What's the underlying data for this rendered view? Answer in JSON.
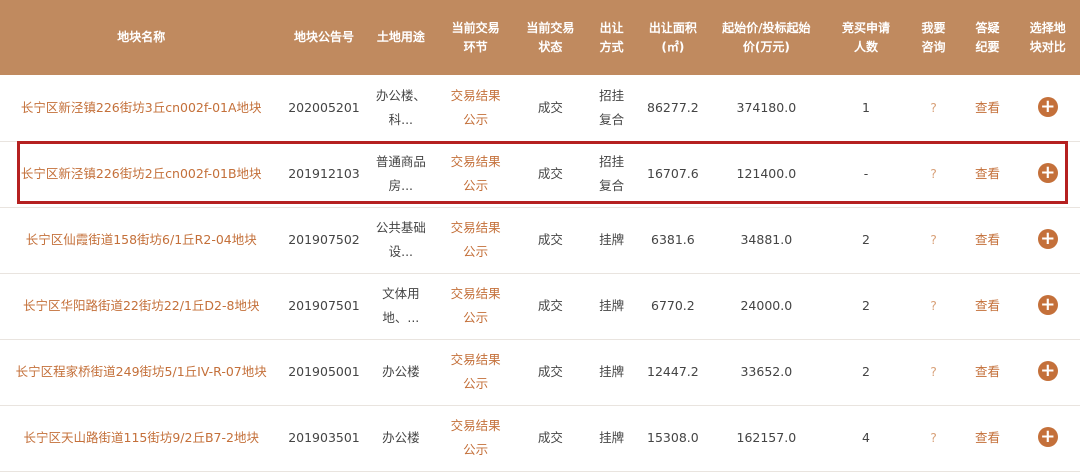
{
  "headers": {
    "name": "地块名称",
    "notice": "地块公告号",
    "usage": "土地用途",
    "stage_1": "当前交易",
    "stage_2": "环节",
    "status_1": "当前交易",
    "status_2": "状态",
    "method_1": "出让",
    "method_2": "方式",
    "area_1": "出让面积",
    "area_2": "(㎡)",
    "price_1": "起始价/投标起始",
    "price_2": "价(万元)",
    "applicants_1": "竞买申请",
    "applicants_2": "人数",
    "consult_1": "我要",
    "consult_2": "咨询",
    "qa_1": "答疑",
    "qa_2": "纪要",
    "compare_1": "选择地",
    "compare_2": "块对比"
  },
  "rows": [
    {
      "name": "长宁区新泾镇226街坊3丘cn002f-01A地块",
      "notice": "202005201",
      "usage_1": "办公楼、",
      "usage_2": "科...",
      "stage_1": "交易结果",
      "stage_2": "公示",
      "status": "成交",
      "method_1": "招挂",
      "method_2": "复合",
      "area": "86277.2",
      "price": "374180.0",
      "applicants": "1",
      "consult": "?",
      "qa": "查看",
      "compare": "+"
    },
    {
      "name": "长宁区新泾镇226街坊2丘cn002f-01B地块",
      "notice": "201912103",
      "usage_1": "普通商品",
      "usage_2": "房...",
      "stage_1": "交易结果",
      "stage_2": "公示",
      "status": "成交",
      "method_1": "招挂",
      "method_2": "复合",
      "area": "16707.6",
      "price": "121400.0",
      "applicants": "-",
      "consult": "?",
      "qa": "查看",
      "compare": "+"
    },
    {
      "name": "长宁区仙霞街道158街坊6/1丘R2-04地块",
      "notice": "201907502",
      "usage_1": "公共基础",
      "usage_2": "设...",
      "stage_1": "交易结果",
      "stage_2": "公示",
      "status": "成交",
      "method_1": "挂牌",
      "method_2": "",
      "area": "6381.6",
      "price": "34881.0",
      "applicants": "2",
      "consult": "?",
      "qa": "查看",
      "compare": "+"
    },
    {
      "name": "长宁区华阳路街道22街坊22/1丘D2-8地块",
      "notice": "201907501",
      "usage_1": "文体用",
      "usage_2": "地、...",
      "stage_1": "交易结果",
      "stage_2": "公示",
      "status": "成交",
      "method_1": "挂牌",
      "method_2": "",
      "area": "6770.2",
      "price": "24000.0",
      "applicants": "2",
      "consult": "?",
      "qa": "查看",
      "compare": "+"
    },
    {
      "name": "长宁区程家桥街道249街坊5/1丘IV-R-07地块",
      "notice": "201905001",
      "usage_1": "办公楼",
      "usage_2": "",
      "stage_1": "交易结果",
      "stage_2": "公示",
      "status": "成交",
      "method_1": "挂牌",
      "method_2": "",
      "area": "12447.2",
      "price": "33652.0",
      "applicants": "2",
      "consult": "?",
      "qa": "查看",
      "compare": "+"
    },
    {
      "name": "长宁区天山路街道115街坊9/2丘B7-2地块",
      "notice": "201903501",
      "usage_1": "办公楼",
      "usage_2": "",
      "stage_1": "交易结果",
      "stage_2": "公示",
      "status": "成交",
      "method_1": "挂牌",
      "method_2": "",
      "area": "15308.0",
      "price": "162157.0",
      "applicants": "4",
      "consult": "?",
      "qa": "查看",
      "compare": "+"
    }
  ],
  "colors": {
    "header_bg": "#c08a5f",
    "link": "#c4703a",
    "highlight_border": "#b52020"
  }
}
